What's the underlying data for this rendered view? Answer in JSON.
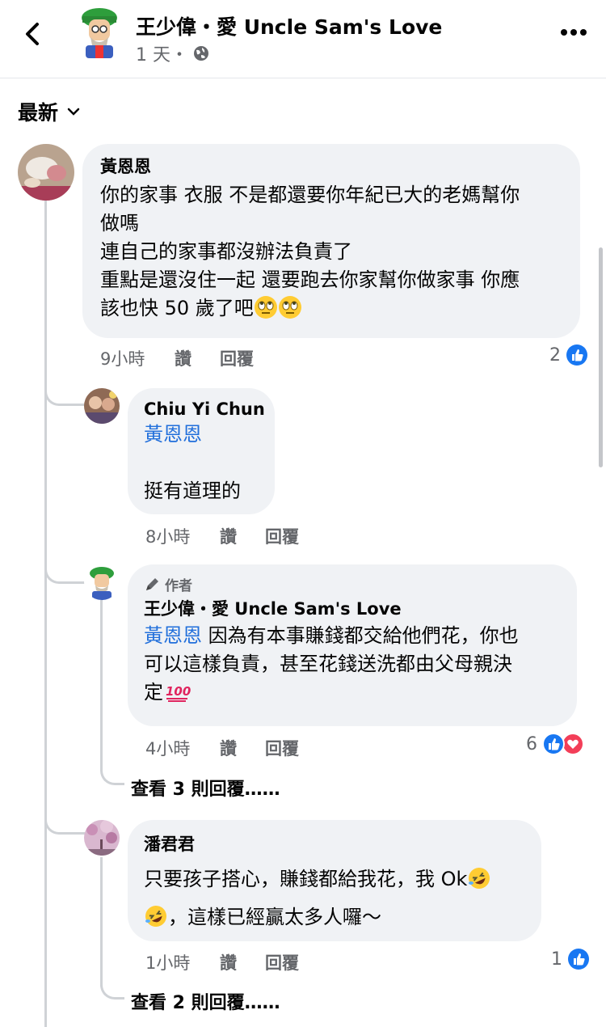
{
  "header": {
    "page_name": "王少偉・愛 Uncle Sam's Love",
    "time": "1 天・"
  },
  "sort": {
    "label": "最新"
  },
  "comments": [
    {
      "author": "黃恩恩",
      "lines": [
        "你的家事 衣服 不是都還要你年紀已大的老媽幫你",
        "做嗎",
        "連自己的家事都沒辦法負責了",
        "重點是還沒住一起 還要跑去你家幫你做家事 你應",
        "該也快 50 歲了吧"
      ],
      "time": "9小時",
      "like_label": "讚",
      "reply_label": "回覆",
      "reaction_count": "2"
    },
    {
      "author": "Chiu Yi Chun",
      "mention": "黃恩恩",
      "text": "挺有道理的",
      "time": "8小時",
      "like_label": "讚",
      "reply_label": "回覆"
    },
    {
      "badge": "作者",
      "author": "王少偉・愛 Uncle Sam's Love",
      "mention": "黃恩恩",
      "lines": [
        " 因為有本事賺錢都交給他們花，你也",
        "可以這樣負責，甚至花錢送洗都由父母親決",
        "定"
      ],
      "time": "4小時",
      "like_label": "讚",
      "reply_label": "回覆",
      "reaction_count": "6",
      "view_replies": "查看 3 則回覆……"
    },
    {
      "author": "潘君君",
      "lines": [
        "只要孩子搭心，賺錢都給我花，我 Ok",
        "，這樣已經贏太多人囉～"
      ],
      "time": "1小時",
      "like_label": "讚",
      "reply_label": "回覆",
      "reaction_count": "1",
      "view_replies": "查看 2 則回覆……"
    }
  ],
  "colors": {
    "accent": "#1877f2",
    "mention": "#216fdb",
    "love": "#f33e58",
    "bubble": "#f0f2f5",
    "muted": "#65676b"
  }
}
